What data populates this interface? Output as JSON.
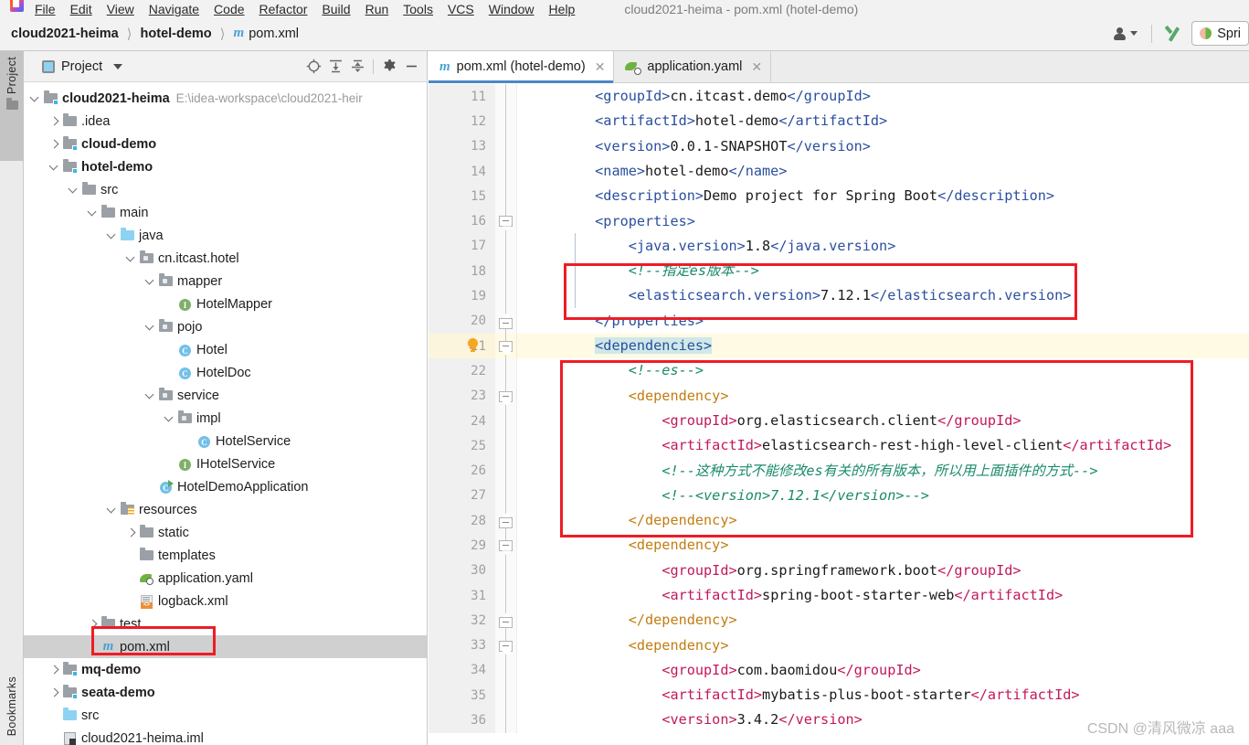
{
  "window": {
    "title": "cloud2021-heima - pom.xml (hotel-demo)",
    "menu": [
      "File",
      "Edit",
      "View",
      "Navigate",
      "Code",
      "Refactor",
      "Build",
      "Run",
      "Tools",
      "VCS",
      "Window",
      "Help"
    ]
  },
  "breadcrumb": {
    "items": [
      "cloud2021-heima",
      "hotel-demo",
      "pom.xml"
    ],
    "separator": "〉",
    "file_icon": "maven-m-icon"
  },
  "toolbar": {
    "account_icon": "user-icon",
    "update_icon": "vcs-update-arrow-icon",
    "run_config_label": "Spri",
    "run_config_icon": "spring-boot-icon"
  },
  "left_stripe": {
    "project_label": "Project",
    "bookmarks_label": "Bookmarks",
    "folder_icon": "folder-icon"
  },
  "project_panel": {
    "title": "Project",
    "title_icon": "project-view-icon",
    "dropdown_icon": "chevron-down-icon",
    "tools": [
      "locate-icon",
      "expand-all-icon",
      "collapse-all-icon",
      "settings-gear-icon",
      "hide-minus-icon"
    ],
    "tree": [
      {
        "label": "cloud2021-heima",
        "path": "E:\\idea-workspace\\cloud2021-heir",
        "indent": 0,
        "twisty": "down",
        "icon": "module-folder",
        "bold": true
      },
      {
        "label": ".idea",
        "indent": 1,
        "twisty": "right",
        "icon": "folder-grey",
        "bold": false
      },
      {
        "label": "cloud-demo",
        "indent": 1,
        "twisty": "right",
        "icon": "module-folder",
        "bold": true
      },
      {
        "label": "hotel-demo",
        "indent": 1,
        "twisty": "down",
        "icon": "module-folder",
        "bold": true
      },
      {
        "label": "src",
        "indent": 2,
        "twisty": "down",
        "icon": "folder-grey",
        "bold": false
      },
      {
        "label": "main",
        "indent": 3,
        "twisty": "down",
        "icon": "folder-grey",
        "bold": false
      },
      {
        "label": "java",
        "indent": 4,
        "twisty": "down",
        "icon": "folder-blue",
        "bold": false
      },
      {
        "label": "cn.itcast.hotel",
        "indent": 5,
        "twisty": "down",
        "icon": "package",
        "bold": false
      },
      {
        "label": "mapper",
        "indent": 6,
        "twisty": "down",
        "icon": "package",
        "bold": false
      },
      {
        "label": "HotelMapper",
        "indent": 7,
        "twisty": "none",
        "icon": "interface",
        "bold": false
      },
      {
        "label": "pojo",
        "indent": 6,
        "twisty": "down",
        "icon": "package",
        "bold": false
      },
      {
        "label": "Hotel",
        "indent": 7,
        "twisty": "none",
        "icon": "class",
        "bold": false
      },
      {
        "label": "HotelDoc",
        "indent": 7,
        "twisty": "none",
        "icon": "class",
        "bold": false
      },
      {
        "label": "service",
        "indent": 6,
        "twisty": "down",
        "icon": "package",
        "bold": false
      },
      {
        "label": "impl",
        "indent": 7,
        "twisty": "down",
        "icon": "package",
        "bold": false
      },
      {
        "label": "HotelService",
        "indent": 8,
        "twisty": "none",
        "icon": "class",
        "bold": false
      },
      {
        "label": "IHotelService",
        "indent": 7,
        "twisty": "none",
        "icon": "interface",
        "bold": false
      },
      {
        "label": "HotelDemoApplication",
        "indent": 6,
        "twisty": "none",
        "icon": "runnable-class",
        "bold": false
      },
      {
        "label": "resources",
        "indent": 4,
        "twisty": "down",
        "icon": "resources-folder",
        "bold": false
      },
      {
        "label": "static",
        "indent": 5,
        "twisty": "right",
        "icon": "folder-grey",
        "bold": false
      },
      {
        "label": "templates",
        "indent": 5,
        "twisty": "none",
        "icon": "folder-grey",
        "bold": false
      },
      {
        "label": "application.yaml",
        "indent": 5,
        "twisty": "none",
        "icon": "spring-yaml",
        "bold": false
      },
      {
        "label": "logback.xml",
        "indent": 5,
        "twisty": "none",
        "icon": "xml-file",
        "bold": false
      },
      {
        "label": "test",
        "indent": 3,
        "twisty": "right",
        "icon": "folder-grey",
        "bold": false
      },
      {
        "label": "pom.xml",
        "indent": 3,
        "twisty": "none",
        "icon": "maven-m",
        "bold": false,
        "selected": true,
        "highlighted": true
      },
      {
        "label": "mq-demo",
        "indent": 1,
        "twisty": "right",
        "icon": "module-folder",
        "bold": true
      },
      {
        "label": "seata-demo",
        "indent": 1,
        "twisty": "right",
        "icon": "module-folder",
        "bold": true
      },
      {
        "label": "src",
        "indent": 1,
        "twisty": "none",
        "icon": "folder-blue",
        "bold": false
      },
      {
        "label": "cloud2021-heima.iml",
        "indent": 1,
        "twisty": "none",
        "icon": "iml-file",
        "bold": false
      }
    ]
  },
  "editor": {
    "tabs": [
      {
        "label": "pom.xml (hotel-demo)",
        "icon": "maven-m-icon",
        "active": true,
        "close_icon": "close-icon"
      },
      {
        "label": "application.yaml",
        "icon": "spring-yaml-icon",
        "active": false,
        "close_icon": "close-icon"
      }
    ],
    "lines": [
      {
        "n": "11",
        "fold": "",
        "indent": 1,
        "text": "        <groupId>cn.itcast.demo</groupId>"
      },
      {
        "n": "12",
        "fold": "",
        "indent": 1,
        "text": "        <artifactId>hotel-demo</artifactId>"
      },
      {
        "n": "13",
        "fold": "",
        "indent": 1,
        "text": "        <version>0.0.1-SNAPSHOT</version>"
      },
      {
        "n": "14",
        "fold": "",
        "indent": 1,
        "text": "        <name>hotel-demo</name>"
      },
      {
        "n": "15",
        "fold": "",
        "indent": 1,
        "text": "        <description>Demo project for Spring Boot</description>"
      },
      {
        "n": "16",
        "fold": "open",
        "indent": 1,
        "text": "        <properties>"
      },
      {
        "n": "17",
        "fold": "",
        "indent": 2,
        "text": "            <java.version>1.8</java.version>"
      },
      {
        "n": "18",
        "fold": "",
        "indent": 2,
        "text": "            <!--指定es版本-->"
      },
      {
        "n": "19",
        "fold": "",
        "indent": 2,
        "text": "            <elasticsearch.version>7.12.1</elasticsearch.version>"
      },
      {
        "n": "20",
        "fold": "close",
        "indent": 1,
        "text": "        </properties>"
      },
      {
        "n": "21",
        "fold": "open",
        "indent": 1,
        "bulb": true,
        "highlight": true,
        "text": "        <dependencies>"
      },
      {
        "n": "22",
        "fold": "",
        "indent": 2,
        "text": "            <!--es-->"
      },
      {
        "n": "23",
        "fold": "open",
        "indent": 2,
        "text": "            <dependency>"
      },
      {
        "n": "24",
        "fold": "",
        "indent": 3,
        "text": "                <groupId>org.elasticsearch.client</groupId>"
      },
      {
        "n": "25",
        "fold": "",
        "indent": 3,
        "text": "                <artifactId>elasticsearch-rest-high-level-client</artifactId>"
      },
      {
        "n": "26",
        "fold": "",
        "indent": 3,
        "text": "                <!--这种方式不能修改es有关的所有版本，所以用上面插件的方式-->"
      },
      {
        "n": "27",
        "fold": "",
        "indent": 3,
        "text": "                <!--<version>7.12.1</version>-->"
      },
      {
        "n": "28",
        "fold": "close",
        "indent": 2,
        "text": "            </dependency>"
      },
      {
        "n": "29",
        "fold": "open",
        "indent": 2,
        "text": "            <dependency>"
      },
      {
        "n": "30",
        "fold": "",
        "indent": 3,
        "text": "                <groupId>org.springframework.boot</groupId>"
      },
      {
        "n": "31",
        "fold": "",
        "indent": 3,
        "text": "                <artifactId>spring-boot-starter-web</artifactId>"
      },
      {
        "n": "32",
        "fold": "close",
        "indent": 2,
        "text": "            </dependency>"
      },
      {
        "n": "33",
        "fold": "open",
        "indent": 2,
        "text": "            <dependency>"
      },
      {
        "n": "34",
        "fold": "",
        "indent": 3,
        "text": "                <groupId>com.baomidou</groupId>"
      },
      {
        "n": "35",
        "fold": "",
        "indent": 3,
        "text": "                <artifactId>mybatis-plus-boot-starter</artifactId>"
      },
      {
        "n": "36",
        "fold": "",
        "indent": 3,
        "text": "                <version>3.4.2</version>"
      }
    ]
  },
  "annotations": {
    "highlight_color": "#ee1c25",
    "boxes": [
      "properties-es-version-box",
      "es-dependency-box",
      "pom-xml-tree-box"
    ]
  },
  "watermark": "CSDN @清风微凉 aaa"
}
